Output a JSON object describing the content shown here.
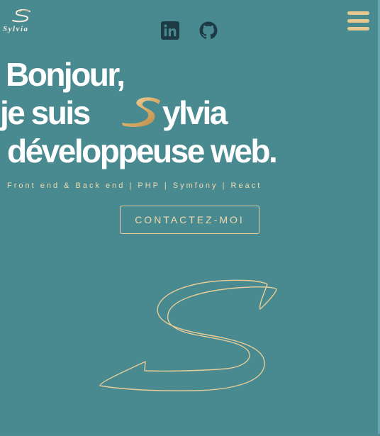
{
  "header": {
    "logo_text": "Sylvia",
    "icons": [
      "linkedin-icon",
      "github-icon",
      "hamburger-menu-icon"
    ]
  },
  "hero": {
    "line1": "Bonjour,",
    "line2_prefix": "je suis",
    "line2_suffix": "ylvia",
    "line3": "développeuse web."
  },
  "skills": "Front end & Back end | PHP | Symfony | React",
  "contact_button": "CONTACTEZ-MOI",
  "colors": {
    "background": "#498990",
    "accent_gold": "#e7c98f",
    "text": "#ffffff"
  }
}
